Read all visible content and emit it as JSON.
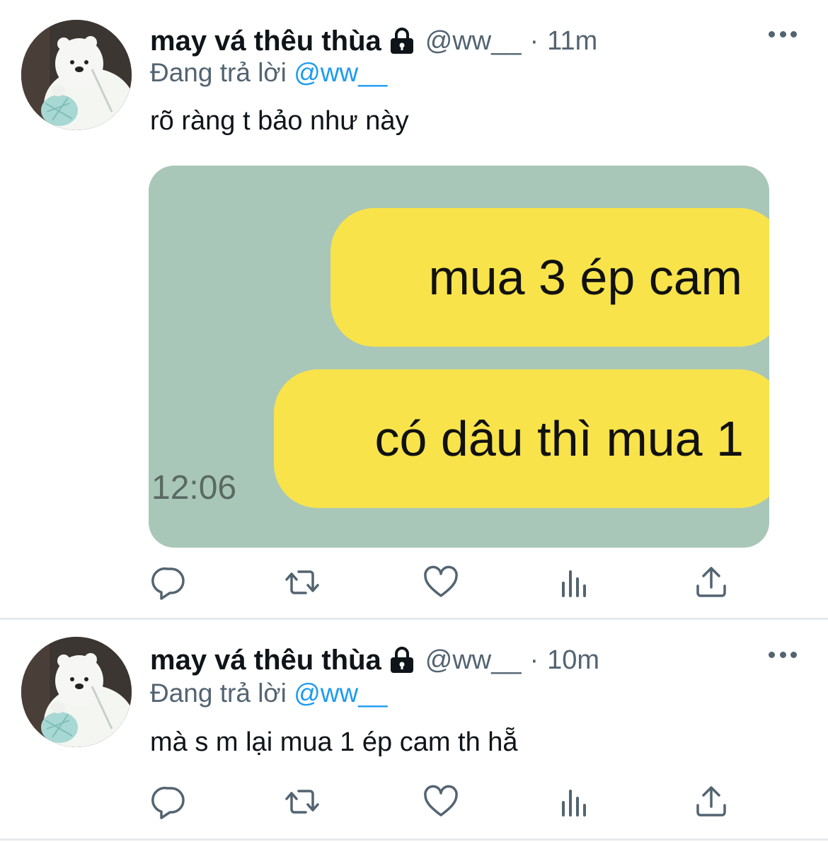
{
  "tweets": [
    {
      "author_name": "may vá thêu thùa",
      "handle": "@ww__",
      "separator": "·",
      "time": "11m",
      "replying_prefix": "Đang trả lời",
      "replying_to": "@ww__",
      "text": "rõ ràng t bảo như này",
      "media": {
        "bubbles": [
          "mua 3 ép cam",
          "có dâu thì mua 1"
        ],
        "chat_time": "12:06",
        "background_color": "#a9c7b8",
        "bubble_color": "#f8e34a"
      }
    },
    {
      "author_name": "may vá thêu thùa",
      "handle": "@ww__",
      "separator": "·",
      "time": "10m",
      "replying_prefix": "Đang trả lời",
      "replying_to": "@ww__",
      "text": "mà s m lại mua 1 ép cam th hẵ"
    }
  ],
  "icons": {
    "avatar": "white-bear-knitting-avatar",
    "lock": "lock-icon",
    "more": "more-icon",
    "actions": [
      "reply-icon",
      "retweet-icon",
      "like-icon",
      "views-icon",
      "share-icon"
    ]
  },
  "colors": {
    "text_primary": "#0f1419",
    "text_secondary": "#536471",
    "link": "#1d9bf0",
    "divider": "#e7eaed"
  }
}
